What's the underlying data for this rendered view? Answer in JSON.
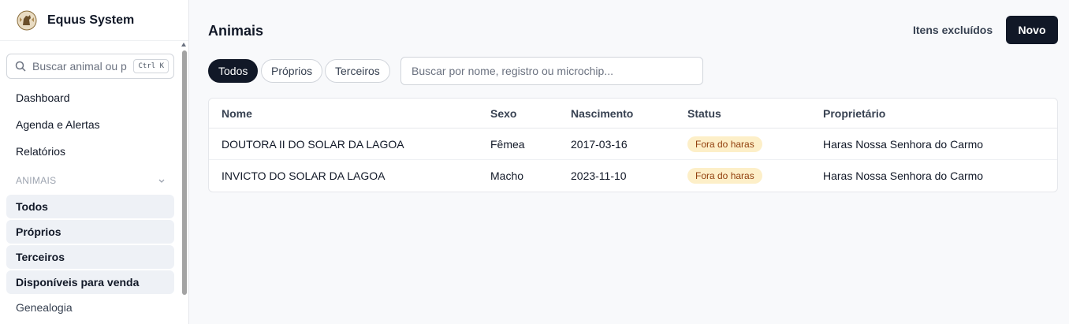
{
  "app": {
    "title": "Equus System",
    "logo_icon": "horse-crest-icon"
  },
  "sidebar": {
    "search": {
      "placeholder": "Buscar animal ou pessoa",
      "shortcut": "Ctrl K"
    },
    "items": [
      {
        "label": "Dashboard"
      },
      {
        "label": "Agenda e Alertas"
      },
      {
        "label": "Relatórios"
      }
    ],
    "section": {
      "label": "ANIMAIS",
      "items": [
        {
          "label": "Todos"
        },
        {
          "label": "Próprios"
        },
        {
          "label": "Terceiros"
        },
        {
          "label": "Disponíveis para venda"
        },
        {
          "label": "Genealogia"
        }
      ]
    }
  },
  "main": {
    "title": "Animais",
    "deleted_label": "Itens excluídos",
    "new_label": "Novo",
    "filters": [
      {
        "label": "Todos",
        "active": true
      },
      {
        "label": "Próprios",
        "active": false
      },
      {
        "label": "Terceiros",
        "active": false
      }
    ],
    "search_placeholder": "Buscar por nome, registro ou microchip...",
    "table": {
      "columns": [
        "Nome",
        "Sexo",
        "Nascimento",
        "Status",
        "Proprietário"
      ],
      "rows": [
        [
          "DOUTORA II DO SOLAR DA LAGOA",
          "Fêmea",
          "2017-03-16",
          "Fora do haras",
          "Haras Nossa Senhora do Carmo"
        ],
        [
          "INVICTO DO SOLAR DA LAGOA",
          "Macho",
          "2023-11-10",
          "Fora do haras",
          "Haras Nossa Senhora do Carmo"
        ]
      ]
    }
  },
  "colors": {
    "primary": "#111827",
    "badge_bg": "#fdefc8",
    "badge_text": "#92400e",
    "active_bg": "#eef1f6"
  }
}
